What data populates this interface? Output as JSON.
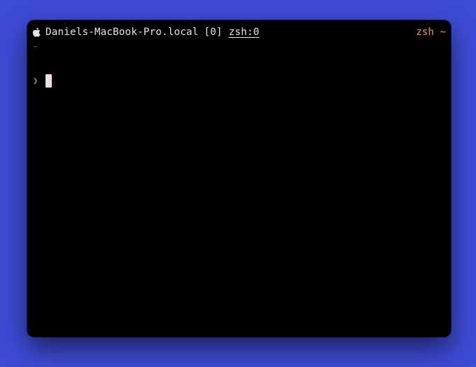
{
  "status_bar": {
    "apple_icon": "apple-logo-icon",
    "hostname": "Daniels-MacBook-Pro.local",
    "window_index": "[0]",
    "window_name": "zsh:0",
    "right_label": "zsh ~"
  },
  "pane": {
    "cwd": "~",
    "prompt_symbol": "❯"
  },
  "colors": {
    "desktop_background": "#3e4bd4",
    "terminal_background": "#000000",
    "status_text": "#e4e4e4",
    "status_right_text": "#e89a4f",
    "cursor": "#f3dede"
  }
}
